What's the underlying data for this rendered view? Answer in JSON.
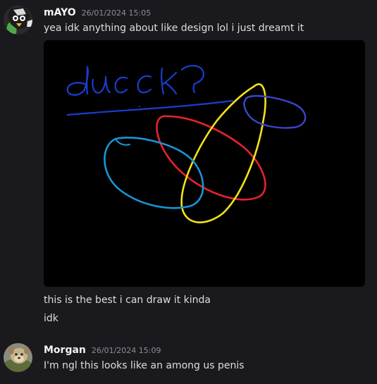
{
  "messages": [
    {
      "author": "mAYO",
      "timestamp": "26/01/2024 15:05",
      "text": "yea idk anything about like design lol i just dreamt it"
    },
    {
      "author": "",
      "timestamp": "",
      "text": "this is the best i can draw it kinda"
    },
    {
      "author": "",
      "timestamp": "",
      "text": "idk"
    },
    {
      "author": "Morgan",
      "timestamp": "26/01/2024 15:09",
      "text": "I'm ngl this looks like an among us penis"
    }
  ],
  "attachment": {
    "scribble_text": "duck?",
    "colors": {
      "blue_text": "#1a3ecf",
      "red": "#e8222a",
      "yellow": "#f5e21a",
      "light_blue": "#1896d6",
      "purple": "#3c45c8",
      "background": "#000000"
    }
  },
  "theme": {
    "background": "#1a1a1e",
    "username": "#f2f3f5",
    "timestamp": "#8c8e94",
    "text": "#dbdee1"
  }
}
